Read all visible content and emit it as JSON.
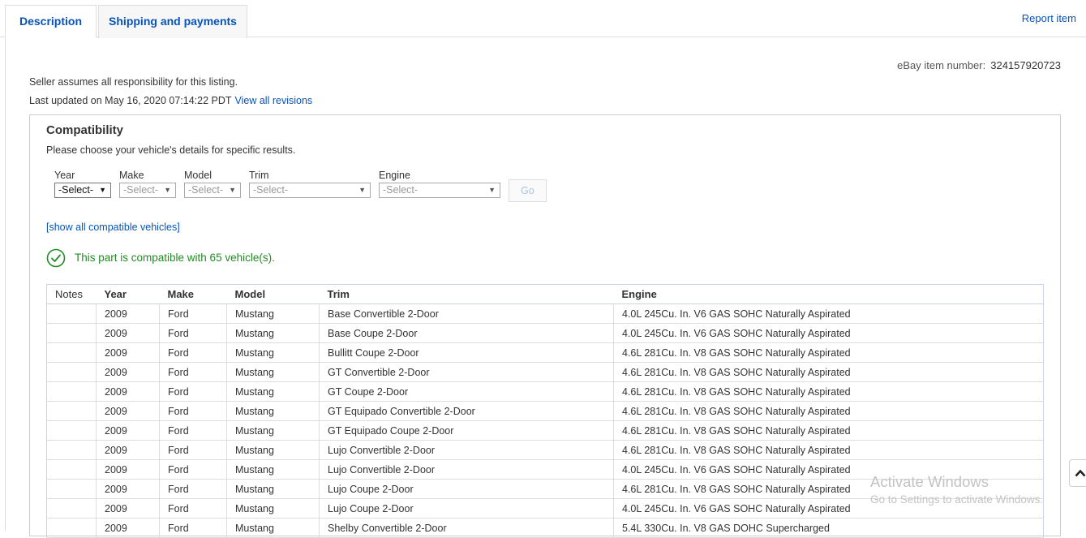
{
  "tabs": [
    {
      "label": "Description",
      "active": true
    },
    {
      "label": "Shipping and payments",
      "active": false
    }
  ],
  "report_link": "Report item",
  "item_number": {
    "label": "eBay item number:",
    "value": "324157920723"
  },
  "responsibility": "Seller assumes all responsibility for this listing.",
  "last_updated": {
    "label": "Last updated on",
    "date": "May 16, 2020 07:14:22 PDT",
    "link": "View all revisions"
  },
  "compatibility": {
    "title": "Compatibility",
    "subtitle": "Please choose your vehicle's details for specific results.",
    "selects": [
      {
        "label": "Year",
        "value": "-Select-",
        "enabled": true
      },
      {
        "label": "Make",
        "value": "-Select-",
        "enabled": false
      },
      {
        "label": "Model",
        "value": "-Select-",
        "enabled": false
      },
      {
        "label": "Trim",
        "value": "-Select-",
        "enabled": false
      },
      {
        "label": "Engine",
        "value": "-Select-",
        "enabled": false
      }
    ],
    "go_label": "Go",
    "show_all_link": "[show all compatible vehicles]",
    "compatible_text": "This part is compatible with 65 vehicle(s).",
    "columns": [
      "Notes",
      "Year",
      "Make",
      "Model",
      "Trim",
      "Engine"
    ],
    "rows": [
      [
        "",
        "2009",
        "Ford",
        "Mustang",
        "Base Convertible 2-Door",
        "4.0L 245Cu. In. V6 GAS SOHC Naturally Aspirated"
      ],
      [
        "",
        "2009",
        "Ford",
        "Mustang",
        "Base Coupe 2-Door",
        "4.0L 245Cu. In. V6 GAS SOHC Naturally Aspirated"
      ],
      [
        "",
        "2009",
        "Ford",
        "Mustang",
        "Bullitt Coupe 2-Door",
        "4.6L 281Cu. In. V8 GAS SOHC Naturally Aspirated"
      ],
      [
        "",
        "2009",
        "Ford",
        "Mustang",
        "GT Convertible 2-Door",
        "4.6L 281Cu. In. V8 GAS SOHC Naturally Aspirated"
      ],
      [
        "",
        "2009",
        "Ford",
        "Mustang",
        "GT Coupe 2-Door",
        "4.6L 281Cu. In. V8 GAS SOHC Naturally Aspirated"
      ],
      [
        "",
        "2009",
        "Ford",
        "Mustang",
        "GT Equipado Convertible 2-Door",
        "4.6L 281Cu. In. V8 GAS SOHC Naturally Aspirated"
      ],
      [
        "",
        "2009",
        "Ford",
        "Mustang",
        "GT Equipado Coupe 2-Door",
        "4.6L 281Cu. In. V8 GAS SOHC Naturally Aspirated"
      ],
      [
        "",
        "2009",
        "Ford",
        "Mustang",
        "Lujo Convertible 2-Door",
        "4.6L 281Cu. In. V8 GAS SOHC Naturally Aspirated"
      ],
      [
        "",
        "2009",
        "Ford",
        "Mustang",
        "Lujo Convertible 2-Door",
        "4.0L 245Cu. In. V6 GAS SOHC Naturally Aspirated"
      ],
      [
        "",
        "2009",
        "Ford",
        "Mustang",
        "Lujo Coupe 2-Door",
        "4.6L 281Cu. In. V8 GAS SOHC Naturally Aspirated"
      ],
      [
        "",
        "2009",
        "Ford",
        "Mustang",
        "Lujo Coupe 2-Door",
        "4.0L 245Cu. In. V6 GAS SOHC Naturally Aspirated"
      ],
      [
        "",
        "2009",
        "Ford",
        "Mustang",
        "Shelby Convertible 2-Door",
        "5.4L 330Cu. In. V8 GAS DOHC Supercharged"
      ]
    ]
  },
  "watermark": {
    "line1": "Activate Windows",
    "line2": "Go to Settings to activate Windows."
  },
  "icons": {
    "check": "check-circle-icon",
    "scroll": "chevron-up-icon",
    "dropdown": "caret-down-icon"
  },
  "colors": {
    "link": "#0654ba",
    "success": "#218c21",
    "table_border": "#c9d3ee"
  }
}
